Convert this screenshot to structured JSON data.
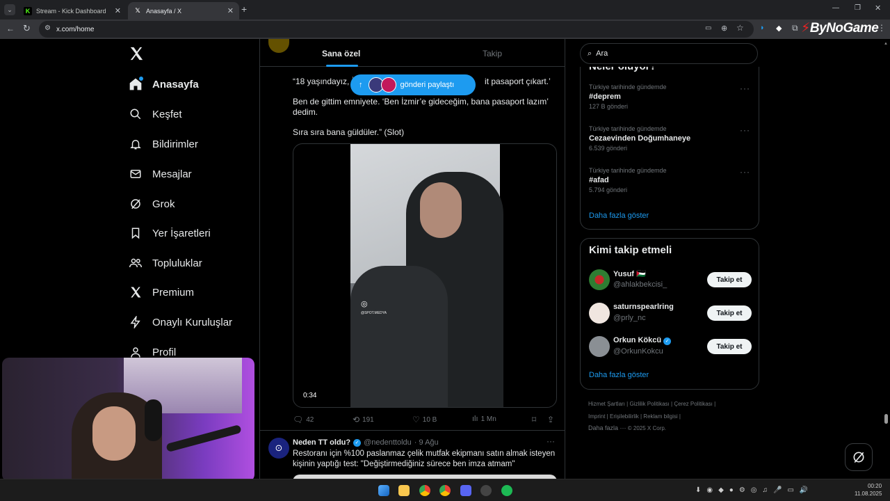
{
  "browser": {
    "tabs": [
      {
        "title": "Stream - Kick Dashboard",
        "active": false
      },
      {
        "title": "Anasayfa / X",
        "active": true
      }
    ],
    "url": "x.com/home",
    "watermark": "ByNoGame"
  },
  "nav": {
    "items": [
      {
        "label": "Anasayfa",
        "icon": "home-icon"
      },
      {
        "label": "Keşfet",
        "icon": "search-icon"
      },
      {
        "label": "Bildirimler",
        "icon": "bell-icon"
      },
      {
        "label": "Mesajlar",
        "icon": "mail-icon"
      },
      {
        "label": "Grok",
        "icon": "grok-icon"
      },
      {
        "label": "Yer İşaretleri",
        "icon": "bookmark-icon"
      },
      {
        "label": "Topluluklar",
        "icon": "people-icon"
      },
      {
        "label": "Premium",
        "icon": "x-logo-icon"
      },
      {
        "label": "Onaylı Kuruluşlar",
        "icon": "lightning-icon"
      },
      {
        "label": "Profil",
        "icon": "person-icon"
      }
    ]
  },
  "feed": {
    "tabs": [
      "Sana özel",
      "Takip"
    ],
    "new_posts_pill": "gönderi paylaştı",
    "post1": {
      "line1": "“18 yaşındayız, İz",
      "line1_end": "it pasaport çıkart.’",
      "para2": "Ben de gittim emniyete. ‘Ben İzmir’e gideceğim, bana pasaport lazım’ dedim.",
      "para3": "Sıra sıra bana güldüler.” (Slot)",
      "video_duration": "0:34",
      "video_watermark": "@SPOT.MEDYA",
      "replies": "42",
      "reposts": "191",
      "likes": "10 B",
      "views": "1 Mn"
    },
    "post2": {
      "name": "Neden TT oldu?",
      "handle": "@nedenttoldu",
      "time": "· 9 Ağu",
      "text": "Restoranı için %100 paslanmaz çelik mutfak ekipmanı satın almak isteyen kişinin yaptığı test: \"Değiştirmediğiniz sürece ben imza atmam\""
    }
  },
  "sidebar": {
    "search_placeholder": "Ara",
    "trends_heading": "Neler oluyor?",
    "trends": [
      {
        "context": "Türkiye tarihinde gündemde",
        "name": "#deprem",
        "count": "127 B gönderi"
      },
      {
        "context": "Türkiye tarihinde gündemde",
        "name": "Cezaevinden Doğumhaneye",
        "count": "6.539 gönderi"
      },
      {
        "context": "Türkiye tarihinde gündemde",
        "name": "#afad",
        "count": "5.794 gönderi"
      }
    ],
    "show_more": "Daha fazla göster",
    "who_to_follow": {
      "heading": "Kimi takip etmeli",
      "users": [
        {
          "name": "Yusuf 🇵🇸",
          "handle": "@ahlakbekcisi_",
          "button": "Takip et"
        },
        {
          "name": "saturnspearlring",
          "handle": "@prly_nc",
          "button": "Takip et"
        },
        {
          "name": "Orkun Kökcü",
          "handle": "@OrkunKokcu",
          "button": "Takip et"
        }
      ],
      "show_more": "Daha fazla göster"
    },
    "footer": {
      "row1": [
        "Hizmet Şartları",
        "Gizlilik Politikası",
        "Çerez Politikası"
      ],
      "row2": [
        "Imprint",
        "Erişilebilirlik",
        "Reklam bilgisi"
      ],
      "row3": [
        "Daha fazla ···",
        "© 2025 X Corp."
      ]
    }
  },
  "taskbar": {
    "time": "00:20",
    "date": "11.08.2025"
  },
  "colors": {
    "accent": "#1d9bf0",
    "kick_green": "#53fc18"
  }
}
